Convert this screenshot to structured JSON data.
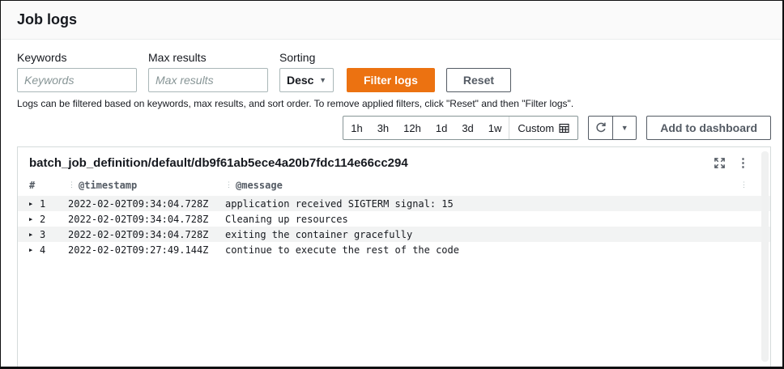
{
  "page_title": "Job logs",
  "filters": {
    "keywords_label": "Keywords",
    "keywords_placeholder": "Keywords",
    "keywords_value": "",
    "max_results_label": "Max results",
    "max_results_placeholder": "Max results",
    "max_results_value": "",
    "sorting_label": "Sorting",
    "sorting_value": "Desc",
    "filter_button_label": "Filter logs",
    "reset_button_label": "Reset",
    "help_text": "Logs can be filtered based on keywords, max results, and sort order. To remove applied filters, click \"Reset\" and then \"Filter logs\"."
  },
  "time_controls": {
    "ranges": [
      "1h",
      "3h",
      "12h",
      "1d",
      "3d",
      "1w"
    ],
    "custom_label": "Custom",
    "add_to_dashboard_label": "Add to dashboard"
  },
  "log_panel": {
    "title": "batch_job_definition/default/db9f61ab5ece4a20b7fdc114e66cc294",
    "columns": {
      "num": "#",
      "timestamp": "@timestamp",
      "message": "@message"
    },
    "rows": [
      {
        "num": "1",
        "timestamp": "2022-02-02T09:34:04.728Z",
        "message": "application received SIGTERM signal: 15"
      },
      {
        "num": "2",
        "timestamp": "2022-02-02T09:34:04.728Z",
        "message": "Cleaning up resources"
      },
      {
        "num": "3",
        "timestamp": "2022-02-02T09:34:04.728Z",
        "message": "exiting the container gracefully"
      },
      {
        "num": "4",
        "timestamp": "2022-02-02T09:27:49.144Z",
        "message": "continue to execute the rest of the code"
      }
    ]
  },
  "icons": {
    "caret_down": "▼",
    "kebab_dots": "⋮",
    "row_expander": "▶",
    "column_divider": "⋮"
  },
  "colors": {
    "accent_orange": "#ec7211",
    "button_gray": "#545b64",
    "row_stripe": "#f2f3f3",
    "header_strip": "#fafafa"
  }
}
